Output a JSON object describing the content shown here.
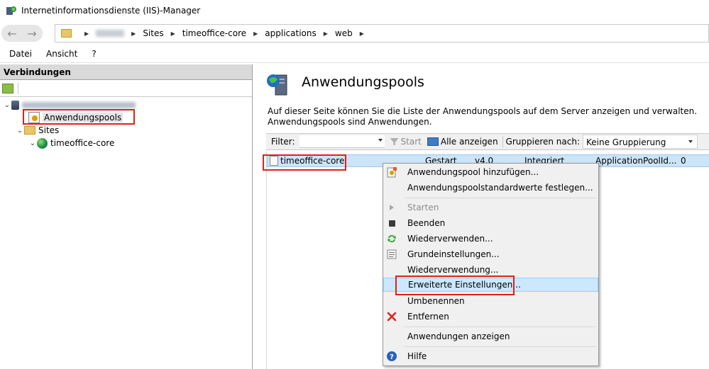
{
  "window": {
    "title": "Internetinformationsdienste (IIS)-Manager"
  },
  "address_bar": {
    "crumbs": [
      "Sites",
      "timeoffice-core",
      "applications",
      "web"
    ]
  },
  "menu": {
    "items": [
      "Datei",
      "Ansicht",
      "?"
    ]
  },
  "connections": {
    "header": "Verbindungen",
    "tree": {
      "app_pools": "Anwendungspools",
      "sites": "Sites",
      "site": "timeoffice-core"
    }
  },
  "main": {
    "title": "Anwendungspools",
    "description": "Auf dieser Seite können Sie die Liste der Anwendungspools auf dem Server anzeigen und verwalten. Anwendungspools sind Anwendungen.",
    "filter": {
      "label": "Filter:",
      "start": "Start",
      "show_all": "Alle anzeigen",
      "group_label": "Gruppieren nach:",
      "group_value": "Keine Gruppierung"
    },
    "row": {
      "name": "timeoffice-core",
      "status": "Gestart",
      "clr": "v4.0",
      "pipeline": "Integriert",
      "identity": "ApplicationPoolId...",
      "apps": "0"
    }
  },
  "context_menu": {
    "add": "Anwendungspool hinzufügen...",
    "defaults": "Anwendungspoolstandardwerte festlegen...",
    "start": "Starten",
    "stop": "Beenden",
    "recycle": "Wiederverwenden...",
    "basic": "Grundeinstellungen...",
    "recycling": "Wiederverwendung...",
    "advanced": "Erweiterte Einstellungen...",
    "rename": "Umbenennen",
    "remove": "Entfernen",
    "view_apps": "Anwendungen anzeigen",
    "help": "Hilfe"
  }
}
